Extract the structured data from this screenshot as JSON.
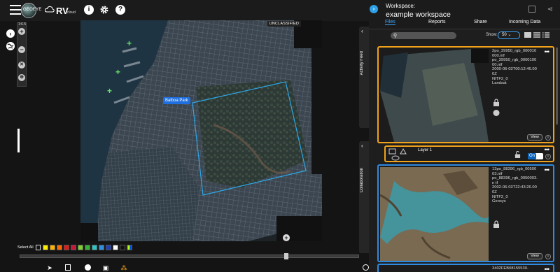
{
  "app": {
    "brand_logo_text": "GEOEYE",
    "name": "RV",
    "name_suffix": "cloud"
  },
  "toolbar": {
    "icons": [
      "info-icon",
      "gear-icon",
      "help-icon"
    ]
  },
  "map": {
    "zoom_level": "1:6.5",
    "classification": "UNCLASSIFIED",
    "place_label": "Balboa Park"
  },
  "palette": {
    "select_all_label": "Select All",
    "colors": [
      "#ffee00",
      "#ffb300",
      "#ff6a00",
      "#e01919",
      "#c4183c",
      "#7fd030",
      "#33b233",
      "#2ec4c4",
      "#2e8fe0",
      "#1f3fb0",
      "#ffffff",
      "#111111",
      "rainbow"
    ]
  },
  "workspace": {
    "label": "Workspace:",
    "name": "example workspace",
    "tabs": [
      "Files",
      "Reports",
      "Share",
      "Incoming Data"
    ],
    "active_tab": "Files",
    "search_placeholder": "",
    "show_label": "Show:",
    "show_value": "50",
    "side_tabs": [
      "Activity Feed",
      "Collaboration"
    ]
  },
  "files": [
    {
      "lines": [
        "2po_39950_rgb_000010000.ntf",
        "po_39950_rgb_0000100 00.ntf",
        "2000-06-03T00:12:46.000Z",
        "NITF2_0",
        "Landsat"
      ],
      "view_label": "View",
      "info_label": "i"
    },
    {
      "lines": [
        "13po_88396_rgb_0050003.ntf",
        "po_88396_rgb_0050003.n tf",
        "2002-06-03T22:43:26.000Z",
        "NITF2_0",
        "Geosys"
      ],
      "view_label": "View",
      "info_label": "i"
    },
    {
      "lines": [
        "3402FEB08155530-"
      ]
    }
  ],
  "layer": {
    "name": "Layer 1",
    "toggle_label": "On",
    "info_label": "i"
  },
  "colors": {
    "accent": "#3fa7ff",
    "selected_border": "#f0a21a",
    "secondary_border": "#2f8ae0",
    "aoi_box": "#2ea8e8"
  }
}
